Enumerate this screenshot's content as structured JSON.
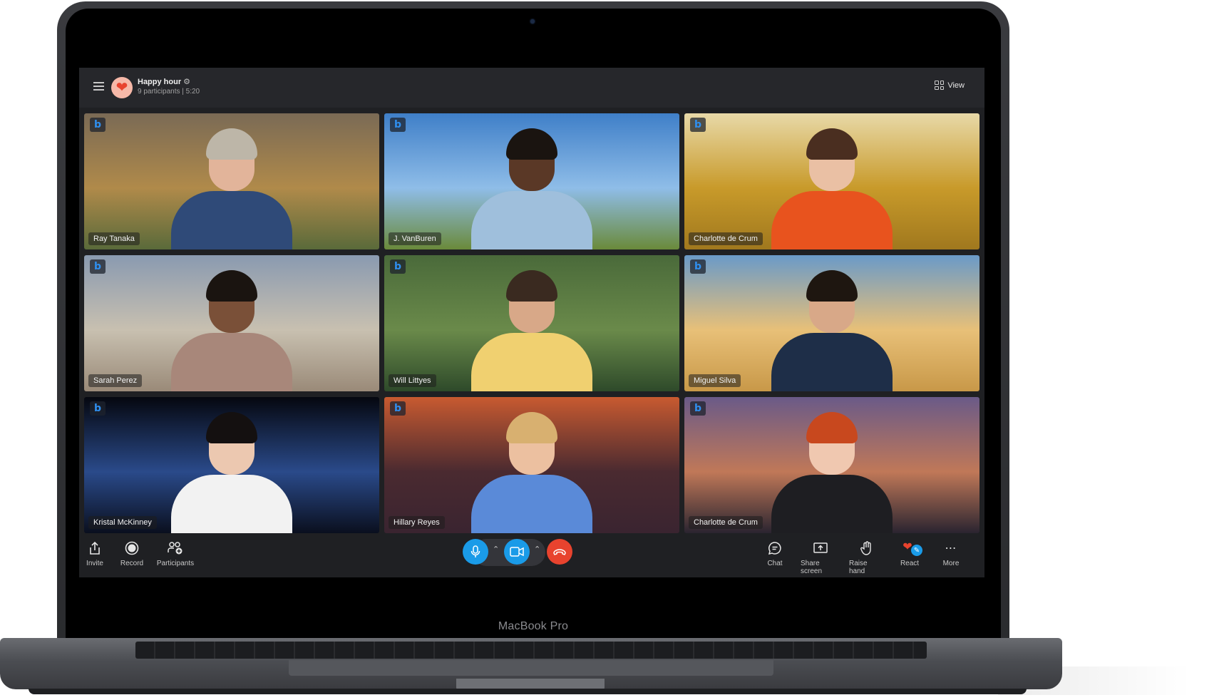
{
  "device": {
    "brand_label": "MacBook Pro"
  },
  "meeting": {
    "title": "Happy hour",
    "participants_text": "9 participants",
    "separator": "|",
    "duration": "5:20",
    "avatar_icon": "heart-icon",
    "view_label": "View"
  },
  "participants": [
    {
      "name": "Ray Tanaka",
      "bg": [
        "#7a6a55",
        "#b08a4a",
        "#5a6a3a"
      ],
      "skin": "#e2b49a",
      "hair": "#bdb6a8",
      "shirt": "#2f4a78"
    },
    {
      "name": "J. VanBuren",
      "bg": [
        "#3f7fc8",
        "#8fbde8",
        "#6a8a3a"
      ],
      "skin": "#5a3826",
      "hair": "#1a1410",
      "shirt": "#9fbfdc"
    },
    {
      "name": "Charlotte de Crum",
      "bg": [
        "#e8d9a8",
        "#c89a2a",
        "#a0781e"
      ],
      "skin": "#eac0a4",
      "hair": "#4a2e20",
      "shirt": "#e8531e"
    },
    {
      "name": "Sarah Perez",
      "bg": [
        "#8a9ab0",
        "#c8c0b0",
        "#9a8a78"
      ],
      "skin": "#7a5038",
      "hair": "#1a1410",
      "shirt": "#a8877a"
    },
    {
      "name": "Will Littyes",
      "bg": [
        "#4a6a3a",
        "#6a8a4a",
        "#2e4a2a"
      ],
      "skin": "#d8a888",
      "hair": "#3a2a20",
      "shirt": "#f0d070"
    },
    {
      "name": "Miguel Silva",
      "bg": [
        "#6a9ac8",
        "#e8c078",
        "#c89848"
      ],
      "skin": "#d8a888",
      "hair": "#1e1610",
      "shirt": "#1e2e48"
    },
    {
      "name": "Kristal McKinney",
      "bg": [
        "#05070f",
        "#2a4a8a",
        "#0a0f1e"
      ],
      "skin": "#ecc8b0",
      "hair": "#141010",
      "shirt": "#f2f2f2"
    },
    {
      "name": "Hillary Reyes",
      "bg": [
        "#c85a30",
        "#4a2a30",
        "#3a2430"
      ],
      "skin": "#ecc0a0",
      "hair": "#d8b070",
      "shirt": "#5a8ad8"
    },
    {
      "name": "Charlotte de Crum",
      "bg": [
        "#6a5a88",
        "#c07858",
        "#2a2430"
      ],
      "skin": "#f0c8b0",
      "hair": "#c8481e",
      "shirt": "#1e1e22"
    }
  ],
  "toolbar": {
    "left": [
      {
        "label": "Invite",
        "icon": "share-icon"
      },
      {
        "label": "Record",
        "icon": "record-icon"
      },
      {
        "label": "Participants",
        "icon": "participants-icon"
      }
    ],
    "call_controls": {
      "mic": "microphone-icon",
      "camera": "video-camera-icon",
      "end_call": "hang-up-icon",
      "mic_color": "#1a9be8",
      "camera_color": "#1a9be8",
      "end_color": "#e8432e"
    },
    "right": [
      {
        "label": "Chat",
        "icon": "chat-icon"
      },
      {
        "label": "Share screen",
        "icon": "share-screen-icon"
      },
      {
        "label": "Raise hand",
        "icon": "raise-hand-icon"
      },
      {
        "label": "React",
        "icon": "heart-react-icon"
      },
      {
        "label": "More",
        "icon": "more-icon"
      }
    ]
  }
}
